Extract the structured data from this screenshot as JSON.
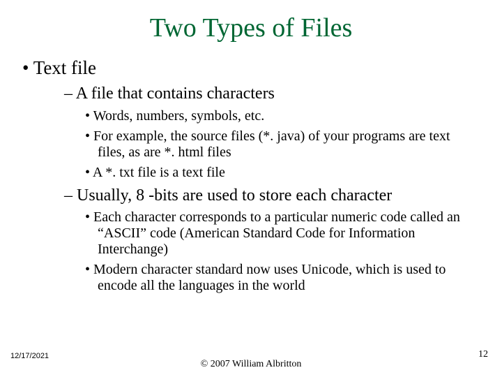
{
  "title": "Two Types of Files",
  "bullets": {
    "l1_1": "Text file",
    "l2_1": "A file that contains characters",
    "l3_1": "Words, numbers, symbols, etc.",
    "l3_2": "For example, the source files (*. java) of your programs are text files, as are *. html files",
    "l3_3": "A *. txt file is a text file",
    "l2_2": "Usually, 8 -bits are used to store each character",
    "l3_4": "Each character corresponds to a particular numeric code called an “ASCII” code (American Standard Code for Information Interchange)",
    "l3_5": "Modern character standard now uses Unicode, which is used to encode all the languages in the world"
  },
  "footer": {
    "date": "12/17/2021",
    "copyright": "© 2007 William Albritton",
    "page": "12"
  }
}
